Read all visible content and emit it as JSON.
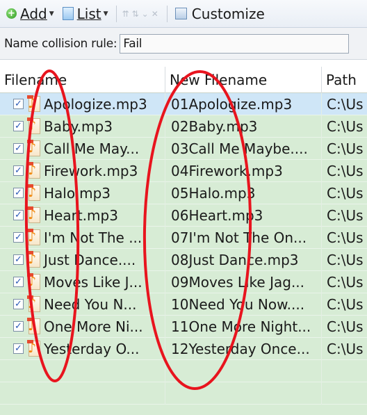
{
  "toolbar": {
    "add_label": "Add",
    "list_label": "List",
    "customize_label": "Customize"
  },
  "collision": {
    "label": "Name collision rule:",
    "value": "Fail"
  },
  "table": {
    "columns": [
      "Filename",
      "New Filename",
      "Path"
    ],
    "rows": [
      {
        "filename": "Apologize.mp3",
        "new_filename": "01Apologize.mp3",
        "path": "C:\\Us"
      },
      {
        "filename": "Baby.mp3",
        "new_filename": "02Baby.mp3",
        "path": "C:\\Us"
      },
      {
        "filename": "Call Me May...",
        "new_filename": "03Call Me Maybe....",
        "path": "C:\\Us"
      },
      {
        "filename": "Firework.mp3",
        "new_filename": "04Firework.mp3",
        "path": "C:\\Us"
      },
      {
        "filename": "Halo.mp3",
        "new_filename": "05Halo.mp3",
        "path": "C:\\Us"
      },
      {
        "filename": "Heart.mp3",
        "new_filename": "06Heart.mp3",
        "path": "C:\\Us"
      },
      {
        "filename": "I'm Not The ...",
        "new_filename": "07I'm Not The On...",
        "path": "C:\\Us"
      },
      {
        "filename": "Just Dance....",
        "new_filename": "08Just Dance.mp3",
        "path": "C:\\Us"
      },
      {
        "filename": "Moves Like J...",
        "new_filename": "09Moves Like Jag...",
        "path": "C:\\Us"
      },
      {
        "filename": "Need You N...",
        "new_filename": "10Need You Now....",
        "path": "C:\\Us"
      },
      {
        "filename": "One More Ni...",
        "new_filename": "11One More Night...",
        "path": "C:\\Us"
      },
      {
        "filename": "Yesterday O...",
        "new_filename": "12Yesterday Once...",
        "path": "C:\\Us"
      }
    ]
  },
  "colors": {
    "row_background": "#d7ecd5",
    "selected_row": "#cfe6f7",
    "annotation_ellipse": "#e8141e",
    "file_icon_accent": "#f08a12"
  }
}
